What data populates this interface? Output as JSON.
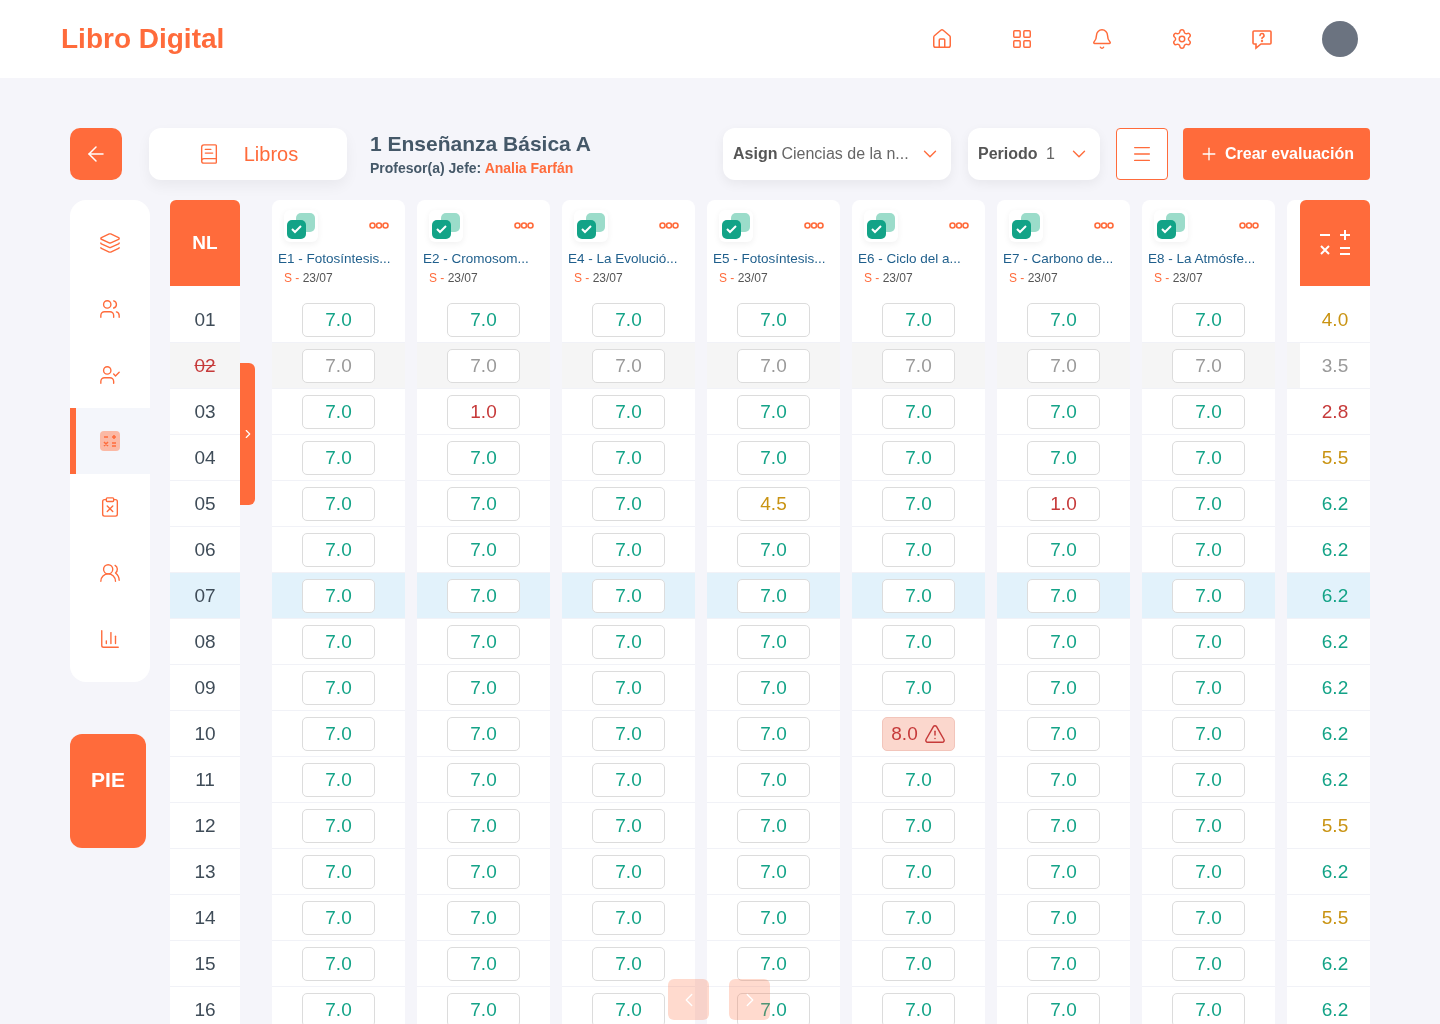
{
  "app": {
    "title": "Libro Digital"
  },
  "toolbar": {
    "books_label": "Libros",
    "course_title": "1 Enseñanza Básica A",
    "teacher_label": "Profesor(a) Jefe:",
    "teacher_name": "Analia Farfán",
    "subject": {
      "label": "Asign",
      "value": "Ciencias de la n..."
    },
    "period": {
      "label": "Periodo",
      "value": "1"
    },
    "create_label": "Crear evaluación"
  },
  "sidebar": {
    "items": [
      {
        "selected": false
      },
      {
        "selected": false
      },
      {
        "selected": false
      },
      {
        "selected": true
      },
      {
        "selected": false
      },
      {
        "selected": false
      },
      {
        "selected": false
      }
    ],
    "pie_label": "PIE"
  },
  "table": {
    "number_heading": "NL",
    "students": [
      {
        "number": "01",
        "withdrawn": false,
        "selected": false,
        "average": "4.0",
        "color": "#c99312"
      },
      {
        "number": "02",
        "withdrawn": true,
        "selected": false,
        "average": "3.5",
        "color": "#9a9a9a"
      },
      {
        "number": "03",
        "withdrawn": false,
        "selected": false,
        "average": "2.8",
        "color": "#c63a3a"
      },
      {
        "number": "04",
        "withdrawn": false,
        "selected": false,
        "average": "5.5",
        "color": "#c99312"
      },
      {
        "number": "05",
        "withdrawn": false,
        "selected": false,
        "average": "6.2",
        "color": "#13a387"
      },
      {
        "number": "06",
        "withdrawn": false,
        "selected": false,
        "average": "6.2",
        "color": "#13a387"
      },
      {
        "number": "07",
        "withdrawn": false,
        "selected": true,
        "average": "6.2",
        "color": "#13a387"
      },
      {
        "number": "08",
        "withdrawn": false,
        "selected": false,
        "average": "6.2",
        "color": "#13a387"
      },
      {
        "number": "09",
        "withdrawn": false,
        "selected": false,
        "average": "6.2",
        "color": "#13a387"
      },
      {
        "number": "10",
        "withdrawn": false,
        "selected": false,
        "average": "6.2",
        "color": "#13a387"
      },
      {
        "number": "11",
        "withdrawn": false,
        "selected": false,
        "average": "6.2",
        "color": "#13a387"
      },
      {
        "number": "12",
        "withdrawn": false,
        "selected": false,
        "average": "5.5",
        "color": "#c99312"
      },
      {
        "number": "13",
        "withdrawn": false,
        "selected": false,
        "average": "6.2",
        "color": "#13a387"
      },
      {
        "number": "14",
        "withdrawn": false,
        "selected": false,
        "average": "5.5",
        "color": "#c99312"
      },
      {
        "number": "15",
        "withdrawn": false,
        "selected": false,
        "average": "6.2",
        "color": "#13a387"
      },
      {
        "number": "16",
        "withdrawn": false,
        "selected": false,
        "average": "6.2",
        "color": "#13a387"
      }
    ],
    "evaluations": [
      {
        "title": "E1 - Fotosíntesis...",
        "type": "S -",
        "date": "23/07",
        "checked": true,
        "grades": [
          {
            "value": "7.0",
            "color": "#13a387",
            "flagged": false
          },
          {
            "value": "7.0",
            "color": "#9a9a9a",
            "flagged": false
          },
          {
            "value": "7.0",
            "color": "#13a387",
            "flagged": false
          },
          {
            "value": "7.0",
            "color": "#13a387",
            "flagged": false
          },
          {
            "value": "7.0",
            "color": "#13a387",
            "flagged": false
          },
          {
            "value": "7.0",
            "color": "#13a387",
            "flagged": false
          },
          {
            "value": "7.0",
            "color": "#13a387",
            "flagged": false
          },
          {
            "value": "7.0",
            "color": "#13a387",
            "flagged": false
          },
          {
            "value": "7.0",
            "color": "#13a387",
            "flagged": false
          },
          {
            "value": "7.0",
            "color": "#13a387",
            "flagged": false
          },
          {
            "value": "7.0",
            "color": "#13a387",
            "flagged": false
          },
          {
            "value": "7.0",
            "color": "#13a387",
            "flagged": false
          },
          {
            "value": "7.0",
            "color": "#13a387",
            "flagged": false
          },
          {
            "value": "7.0",
            "color": "#13a387",
            "flagged": false
          },
          {
            "value": "7.0",
            "color": "#13a387",
            "flagged": false
          },
          {
            "value": "7.0",
            "color": "#13a387",
            "flagged": false
          }
        ]
      },
      {
        "title": "E2 - Cromosom...",
        "type": "S -",
        "date": "23/07",
        "checked": true,
        "grades": [
          {
            "value": "7.0",
            "color": "#13a387",
            "flagged": false
          },
          {
            "value": "7.0",
            "color": "#9a9a9a",
            "flagged": false
          },
          {
            "value": "1.0",
            "color": "#c63a3a",
            "flagged": false
          },
          {
            "value": "7.0",
            "color": "#13a387",
            "flagged": false
          },
          {
            "value": "7.0",
            "color": "#13a387",
            "flagged": false
          },
          {
            "value": "7.0",
            "color": "#13a387",
            "flagged": false
          },
          {
            "value": "7.0",
            "color": "#13a387",
            "flagged": false
          },
          {
            "value": "7.0",
            "color": "#13a387",
            "flagged": false
          },
          {
            "value": "7.0",
            "color": "#13a387",
            "flagged": false
          },
          {
            "value": "7.0",
            "color": "#13a387",
            "flagged": false
          },
          {
            "value": "7.0",
            "color": "#13a387",
            "flagged": false
          },
          {
            "value": "7.0",
            "color": "#13a387",
            "flagged": false
          },
          {
            "value": "7.0",
            "color": "#13a387",
            "flagged": false
          },
          {
            "value": "7.0",
            "color": "#13a387",
            "flagged": false
          },
          {
            "value": "7.0",
            "color": "#13a387",
            "flagged": false
          },
          {
            "value": "7.0",
            "color": "#13a387",
            "flagged": false
          }
        ]
      },
      {
        "title": "E4 - La Evolució...",
        "type": "S -",
        "date": "23/07",
        "checked": true,
        "grades": [
          {
            "value": "7.0",
            "color": "#13a387",
            "flagged": false
          },
          {
            "value": "7.0",
            "color": "#9a9a9a",
            "flagged": false
          },
          {
            "value": "7.0",
            "color": "#13a387",
            "flagged": false
          },
          {
            "value": "7.0",
            "color": "#13a387",
            "flagged": false
          },
          {
            "value": "7.0",
            "color": "#13a387",
            "flagged": false
          },
          {
            "value": "7.0",
            "color": "#13a387",
            "flagged": false
          },
          {
            "value": "7.0",
            "color": "#13a387",
            "flagged": false
          },
          {
            "value": "7.0",
            "color": "#13a387",
            "flagged": false
          },
          {
            "value": "7.0",
            "color": "#13a387",
            "flagged": false
          },
          {
            "value": "7.0",
            "color": "#13a387",
            "flagged": false
          },
          {
            "value": "7.0",
            "color": "#13a387",
            "flagged": false
          },
          {
            "value": "7.0",
            "color": "#13a387",
            "flagged": false
          },
          {
            "value": "7.0",
            "color": "#13a387",
            "flagged": false
          },
          {
            "value": "7.0",
            "color": "#13a387",
            "flagged": false
          },
          {
            "value": "7.0",
            "color": "#13a387",
            "flagged": false
          },
          {
            "value": "7.0",
            "color": "#13a387",
            "flagged": false
          }
        ]
      },
      {
        "title": "E5 - Fotosíntesis...",
        "type": "S -",
        "date": "23/07",
        "checked": true,
        "grades": [
          {
            "value": "7.0",
            "color": "#13a387",
            "flagged": false
          },
          {
            "value": "7.0",
            "color": "#9a9a9a",
            "flagged": false
          },
          {
            "value": "7.0",
            "color": "#13a387",
            "flagged": false
          },
          {
            "value": "7.0",
            "color": "#13a387",
            "flagged": false
          },
          {
            "value": "4.5",
            "color": "#c99312",
            "flagged": false
          },
          {
            "value": "7.0",
            "color": "#13a387",
            "flagged": false
          },
          {
            "value": "7.0",
            "color": "#13a387",
            "flagged": false
          },
          {
            "value": "7.0",
            "color": "#13a387",
            "flagged": false
          },
          {
            "value": "7.0",
            "color": "#13a387",
            "flagged": false
          },
          {
            "value": "7.0",
            "color": "#13a387",
            "flagged": false
          },
          {
            "value": "7.0",
            "color": "#13a387",
            "flagged": false
          },
          {
            "value": "7.0",
            "color": "#13a387",
            "flagged": false
          },
          {
            "value": "7.0",
            "color": "#13a387",
            "flagged": false
          },
          {
            "value": "7.0",
            "color": "#13a387",
            "flagged": false
          },
          {
            "value": "7.0",
            "color": "#13a387",
            "flagged": false
          },
          {
            "value": "7.0",
            "color": "#13a387",
            "flagged": false
          }
        ]
      },
      {
        "title": "E6 - Ciclo del a...",
        "type": "S -",
        "date": "23/07",
        "checked": true,
        "grades": [
          {
            "value": "7.0",
            "color": "#13a387",
            "flagged": false
          },
          {
            "value": "7.0",
            "color": "#9a9a9a",
            "flagged": false
          },
          {
            "value": "7.0",
            "color": "#13a387",
            "flagged": false
          },
          {
            "value": "7.0",
            "color": "#13a387",
            "flagged": false
          },
          {
            "value": "7.0",
            "color": "#13a387",
            "flagged": false
          },
          {
            "value": "7.0",
            "color": "#13a387",
            "flagged": false
          },
          {
            "value": "7.0",
            "color": "#13a387",
            "flagged": false
          },
          {
            "value": "7.0",
            "color": "#13a387",
            "flagged": false
          },
          {
            "value": "7.0",
            "color": "#13a387",
            "flagged": false
          },
          {
            "value": "8.0",
            "color": "#c63a3a",
            "flagged": true
          },
          {
            "value": "7.0",
            "color": "#13a387",
            "flagged": false
          },
          {
            "value": "7.0",
            "color": "#13a387",
            "flagged": false
          },
          {
            "value": "7.0",
            "color": "#13a387",
            "flagged": false
          },
          {
            "value": "7.0",
            "color": "#13a387",
            "flagged": false
          },
          {
            "value": "7.0",
            "color": "#13a387",
            "flagged": false
          },
          {
            "value": "7.0",
            "color": "#13a387",
            "flagged": false
          }
        ]
      },
      {
        "title": "E7 - Carbono de...",
        "type": "S -",
        "date": "23/07",
        "checked": true,
        "grades": [
          {
            "value": "7.0",
            "color": "#13a387",
            "flagged": false
          },
          {
            "value": "7.0",
            "color": "#9a9a9a",
            "flagged": false
          },
          {
            "value": "7.0",
            "color": "#13a387",
            "flagged": false
          },
          {
            "value": "7.0",
            "color": "#13a387",
            "flagged": false
          },
          {
            "value": "1.0",
            "color": "#c63a3a",
            "flagged": false
          },
          {
            "value": "7.0",
            "color": "#13a387",
            "flagged": false
          },
          {
            "value": "7.0",
            "color": "#13a387",
            "flagged": false
          },
          {
            "value": "7.0",
            "color": "#13a387",
            "flagged": false
          },
          {
            "value": "7.0",
            "color": "#13a387",
            "flagged": false
          },
          {
            "value": "7.0",
            "color": "#13a387",
            "flagged": false
          },
          {
            "value": "7.0",
            "color": "#13a387",
            "flagged": false
          },
          {
            "value": "7.0",
            "color": "#13a387",
            "flagged": false
          },
          {
            "value": "7.0",
            "color": "#13a387",
            "flagged": false
          },
          {
            "value": "7.0",
            "color": "#13a387",
            "flagged": false
          },
          {
            "value": "7.0",
            "color": "#13a387",
            "flagged": false
          },
          {
            "value": "7.0",
            "color": "#13a387",
            "flagged": false
          }
        ]
      },
      {
        "title": "E8 - La Atmósfe...",
        "type": "S -",
        "date": "23/07",
        "checked": true,
        "grades": [
          {
            "value": "7.0",
            "color": "#13a387",
            "flagged": false
          },
          {
            "value": "7.0",
            "color": "#9a9a9a",
            "flagged": false
          },
          {
            "value": "7.0",
            "color": "#13a387",
            "flagged": false
          },
          {
            "value": "7.0",
            "color": "#13a387",
            "flagged": false
          },
          {
            "value": "7.0",
            "color": "#13a387",
            "flagged": false
          },
          {
            "value": "7.0",
            "color": "#13a387",
            "flagged": false
          },
          {
            "value": "7.0",
            "color": "#13a387",
            "flagged": false
          },
          {
            "value": "7.0",
            "color": "#13a387",
            "flagged": false
          },
          {
            "value": "7.0",
            "color": "#13a387",
            "flagged": false
          },
          {
            "value": "7.0",
            "color": "#13a387",
            "flagged": false
          },
          {
            "value": "7.0",
            "color": "#13a387",
            "flagged": false
          },
          {
            "value": "7.0",
            "color": "#13a387",
            "flagged": false
          },
          {
            "value": "7.0",
            "color": "#13a387",
            "flagged": false
          },
          {
            "value": "7.0",
            "color": "#13a387",
            "flagged": false
          },
          {
            "value": "7.0",
            "color": "#13a387",
            "flagged": false
          },
          {
            "value": "7.0",
            "color": "#13a387",
            "flagged": false
          }
        ]
      }
    ]
  }
}
